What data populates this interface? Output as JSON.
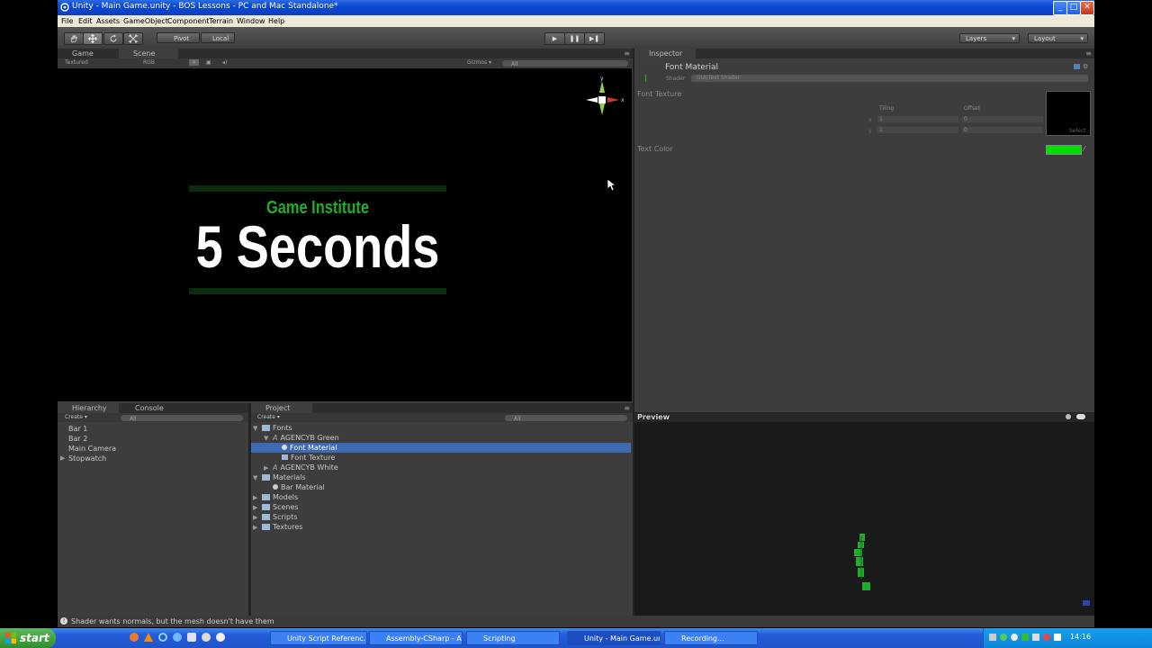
{
  "window": {
    "title": "Unity - Main Game.unity - BOS Lessons - PC and Mac Standalone*",
    "minimize": "_",
    "maximize": "□",
    "close": "✕"
  },
  "menu": [
    "File",
    "Edit",
    "Assets",
    "GameObject",
    "Component",
    "Terrain",
    "Window",
    "Help"
  ],
  "toolbar": {
    "pivot": "Pivot",
    "local": "Local",
    "play": "▶",
    "pause": "❚❚",
    "step": "▶❚",
    "layers": "Layers",
    "layout": "Layout"
  },
  "scene_view": {
    "tabs": [
      "Game",
      "Scene"
    ],
    "controls": {
      "mode": "Textured",
      "channel": "RGB",
      "gizmos": "Gizmos ▾",
      "search": "All"
    },
    "gizmo_axes": {
      "y": "y",
      "x": "x"
    },
    "text_game_institute": "Game Institute",
    "text_seconds": "5 Seconds",
    "colors": {
      "green": "#1fae2a",
      "bar": "#0c2a0c"
    }
  },
  "inspector": {
    "tab": "Inspector",
    "material_name": "Font Material",
    "shader_label": "Shader",
    "shader_value": "GUI/Text Shader",
    "font_texture_label": "Font Texture",
    "tiling_label": "Tiling",
    "offset_label": "Offset",
    "x_label": "x",
    "y_label": "y",
    "tiling_x": "1",
    "tiling_y": "1",
    "offset_x": "0",
    "offset_y": "0",
    "select_label": "Select",
    "text_color_label": "Text Color",
    "text_color": "#00e000"
  },
  "preview": {
    "label": "Preview"
  },
  "hierarchy": {
    "tabs": [
      "Hierarchy",
      "Console"
    ],
    "create": "Create ▾",
    "search": "All",
    "items": [
      "Bar 1",
      "Bar 2",
      "Main Camera",
      "Stopwatch"
    ]
  },
  "project": {
    "tab": "Project",
    "create": "Create ▾",
    "search": "All",
    "items": [
      {
        "label": "Fonts"
      },
      {
        "label": "AGENCYB Green"
      },
      {
        "label": "Font Material"
      },
      {
        "label": "Font Texture"
      },
      {
        "label": "AGENCYB White"
      },
      {
        "label": "Materials"
      },
      {
        "label": "Bar Material"
      },
      {
        "label": "Models"
      },
      {
        "label": "Scenes"
      },
      {
        "label": "Scripts"
      },
      {
        "label": "Textures"
      }
    ]
  },
  "status_bar": {
    "message": "Shader wants normals, but the mesh  doesn't have them"
  },
  "taskbar": {
    "start": "start",
    "tasks": [
      "Unity Script Referenc...",
      "Assembly-CSharp - A...",
      "Scripting",
      "Unity - Main Game.un...",
      "Recording..."
    ],
    "clock": "14:16"
  }
}
